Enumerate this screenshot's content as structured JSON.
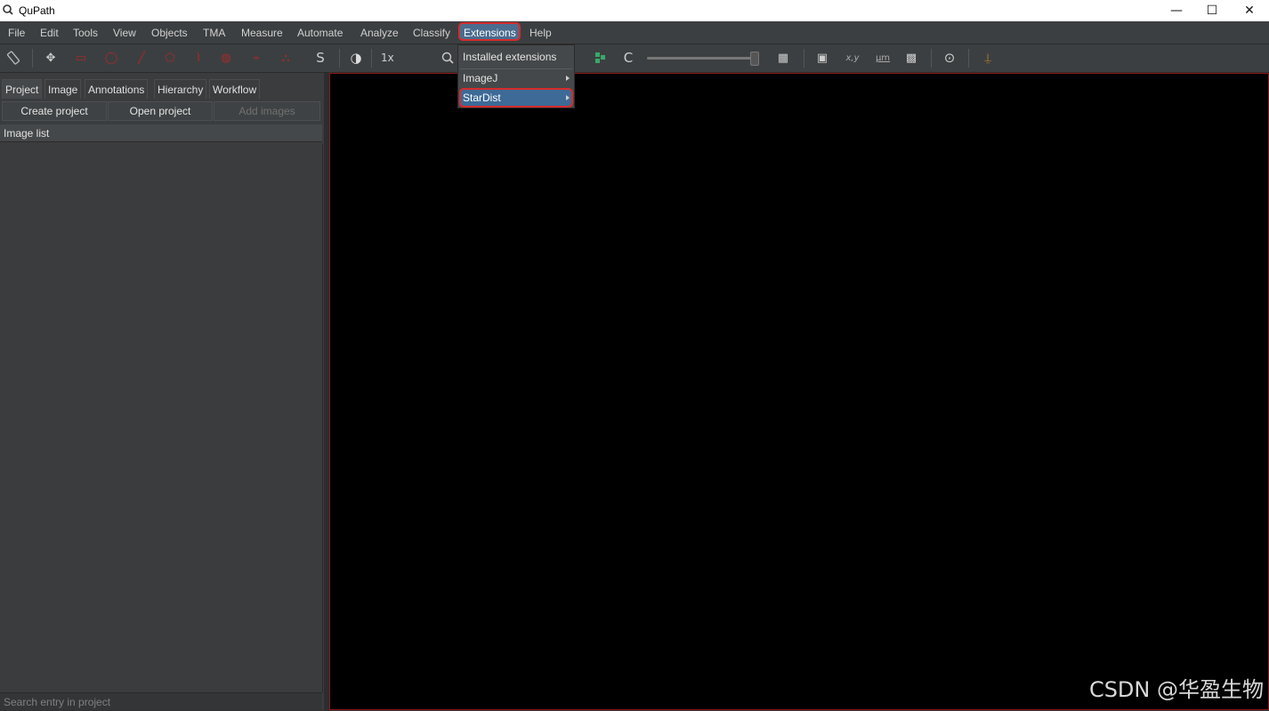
{
  "window": {
    "title": "QuPath",
    "controls": {
      "minimize": "—",
      "maximize": "☐",
      "close": "✕"
    }
  },
  "menubar": {
    "items": [
      "File",
      "Edit",
      "Tools",
      "View",
      "Objects",
      "TMA",
      "Measure",
      "Automate",
      "Analyze",
      "Classify",
      "Extensions",
      "Help"
    ],
    "active": "Extensions"
  },
  "toolbar": {
    "zoom_label": "1x",
    "s_label": "S",
    "c_label": "C",
    "xy_label": "x,y",
    "um_label": "μm"
  },
  "extensions_menu": {
    "items": [
      {
        "label": "Installed extensions",
        "submenu": false
      },
      {
        "label": "ImageJ",
        "submenu": true
      },
      {
        "label": "StarDist",
        "submenu": true,
        "highlighted": true
      }
    ]
  },
  "left_panel": {
    "tabs": [
      "Project",
      "Image",
      "Annotations",
      "Hierarchy",
      "Workflow"
    ],
    "active_tab": "Project",
    "buttons": {
      "create_project": "Create project",
      "open_project": "Open project",
      "add_images": "Add images"
    },
    "image_list_header": "Image list",
    "search_placeholder": "Search entry in project"
  },
  "watermark": "CSDN @华盈生物",
  "colors": {
    "highlight_border": "#d62b2b",
    "viewer_border": "#8b1a1a"
  }
}
